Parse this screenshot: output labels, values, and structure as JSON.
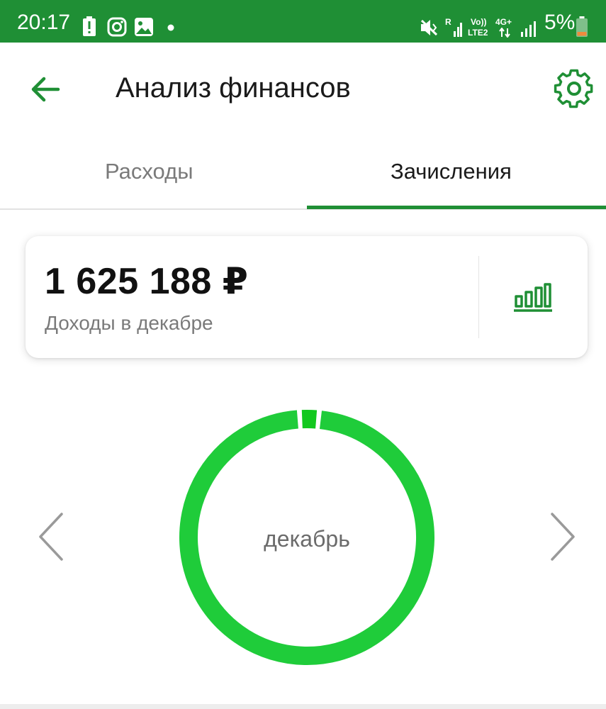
{
  "status_bar": {
    "time": "20:17",
    "network_r": "R",
    "volte_top": "Vo))",
    "volte_bottom": "LTE2",
    "network_4g": "4G+",
    "battery_percent": "5%",
    "icons": [
      "battery-alert-icon",
      "instagram-icon",
      "gallery-icon",
      "notification-dot-icon",
      "mute-vibrate-icon",
      "signal-icon",
      "battery-icon"
    ]
  },
  "header": {
    "title": "Анализ финансов",
    "back_icon": "arrow-left-icon",
    "settings_icon": "gear-icon"
  },
  "tabs": [
    {
      "label": "Расходы",
      "active": false
    },
    {
      "label": "Зачисления",
      "active": true
    }
  ],
  "summary": {
    "amount": "1 625 188 ₽",
    "caption": "Доходы в декабре",
    "chart_icon": "bar-chart-icon"
  },
  "donut": {
    "label": "декабрь",
    "segments": [
      {
        "color": "#1fcc3a",
        "share": 0.975
      },
      {
        "color": "#12c81f",
        "share": 0.025
      }
    ]
  },
  "colors": {
    "brand_green": "#1f8f35",
    "chart_green": "#1fcc3a",
    "text_primary": "#1a1a1a",
    "text_secondary": "#7a7a7a"
  }
}
